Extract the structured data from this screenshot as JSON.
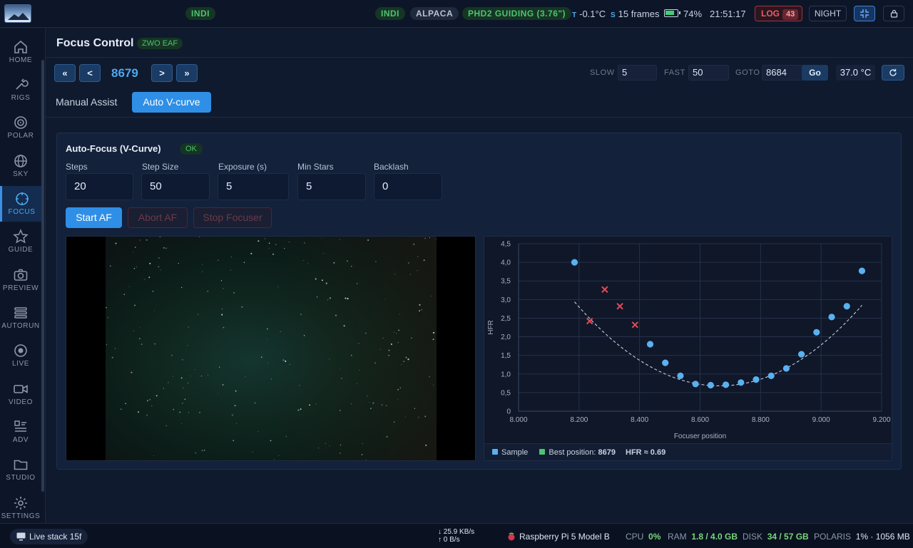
{
  "topbar": {
    "indi_left": "INDI",
    "indi": "INDI",
    "alpaca": "ALPACA",
    "phd2": "PHD2 GUIDING (3.76\")",
    "temp_key": "T",
    "temp_val": "-0.1°C",
    "frames_key": "S",
    "frames_val": "15 frames",
    "battery": "74%",
    "time": "21:51:17",
    "log_label": "LOG",
    "log_count": "43",
    "night_label": "NIGHT",
    "colors": {
      "accent": "#2f8fe6",
      "ok": "#4cc46f",
      "danger": "#ee5b65"
    }
  },
  "sidebar": {
    "items": [
      {
        "label": "HOME",
        "icon": "home-icon"
      },
      {
        "label": "RIGS",
        "icon": "wrench-icon"
      },
      {
        "label": "POLAR",
        "icon": "target-icon"
      },
      {
        "label": "SKY",
        "icon": "globe-icon"
      },
      {
        "label": "FOCUS",
        "icon": "focus-icon",
        "active": true
      },
      {
        "label": "GUIDE",
        "icon": "star-icon"
      },
      {
        "label": "PREVIEW",
        "icon": "camera-icon"
      },
      {
        "label": "AUTORUN",
        "icon": "stack-icon"
      },
      {
        "label": "LIVE",
        "icon": "record-icon"
      },
      {
        "label": "VIDEO",
        "icon": "video-icon"
      },
      {
        "label": "ADV",
        "icon": "list-icon"
      },
      {
        "label": "STUDIO",
        "icon": "folder-icon"
      },
      {
        "label": "SETTINGS",
        "icon": "gear-icon"
      }
    ]
  },
  "header": {
    "title": "Focus Control",
    "device": "ZWO EAF"
  },
  "control": {
    "btn_first": "«",
    "btn_prev": "<",
    "position": "8679",
    "btn_next": ">",
    "btn_last": "»",
    "slow_label": "SLOW",
    "slow_value": "5",
    "fast_label": "FAST",
    "fast_value": "50",
    "goto_label": "GOTO",
    "goto_value": "8684",
    "go_label": "Go",
    "temperature": "37.0 °C"
  },
  "tabs": {
    "manual": "Manual Assist",
    "auto": "Auto V-curve"
  },
  "af": {
    "title": "Auto-Focus (V-Curve)",
    "status": "OK",
    "fields": [
      {
        "label": "Steps",
        "value": "20"
      },
      {
        "label": "Step Size",
        "value": "50"
      },
      {
        "label": "Exposure (s)",
        "value": "5"
      },
      {
        "label": "Min Stars",
        "value": "5"
      },
      {
        "label": "Backlash",
        "value": "0"
      }
    ],
    "start": "Start AF",
    "abort": "Abort AF",
    "stop": "Stop Focuser"
  },
  "legend": {
    "sample": "Sample",
    "best_label": "Best position:",
    "best_value": "8679",
    "hfr": "HFR ≈ 0.69",
    "sample_color": "#5ab0f0",
    "best_color": "#4cc46f"
  },
  "chart_data": {
    "type": "scatter",
    "xlabel": "Focuser position",
    "ylabel": "HFR",
    "xlim": [
      8000,
      9200
    ],
    "ylim": [
      0,
      4.5
    ],
    "xticks": [
      "8.000",
      "8.200",
      "8.400",
      "8.600",
      "8.800",
      "9.000",
      "9.200"
    ],
    "yticks": [
      "0",
      "0,5",
      "1,0",
      "1,5",
      "2,0",
      "2,5",
      "3,0",
      "3,5",
      "4,0",
      "4,5"
    ],
    "grid": true,
    "series": [
      {
        "name": "Sample",
        "color": "#5ab0f0",
        "marker": "circle",
        "points": [
          [
            8185,
            4.0
          ],
          [
            8435,
            1.8
          ],
          [
            8485,
            1.3
          ],
          [
            8535,
            0.95
          ],
          [
            8585,
            0.73
          ],
          [
            8635,
            0.7
          ],
          [
            8685,
            0.71
          ],
          [
            8735,
            0.77
          ],
          [
            8785,
            0.85
          ],
          [
            8835,
            0.95
          ],
          [
            8885,
            1.15
          ],
          [
            8935,
            1.53
          ],
          [
            8985,
            2.12
          ],
          [
            9035,
            2.53
          ],
          [
            9085,
            2.82
          ],
          [
            9135,
            3.77
          ]
        ]
      },
      {
        "color": "#e04a55",
        "marker": "x",
        "points": [
          [
            8235,
            2.42
          ],
          [
            8285,
            3.27
          ],
          [
            8335,
            2.82
          ],
          [
            8385,
            2.32
          ]
        ]
      }
    ],
    "fit": {
      "style": "dashed",
      "color": "#c8d0dc",
      "a": 9.8e-06,
      "h": 8665,
      "k": 0.68
    }
  },
  "statusbar": {
    "livestack": "Live stack 15f",
    "down": "25.9 KB/s",
    "up": "0 B/s",
    "device": "Raspberry Pi 5 Model B",
    "cpu_label": "CPU",
    "cpu": "0%",
    "ram_label": "RAM",
    "ram": "1.8 / 4.0 GB",
    "disk_label": "DISK",
    "disk": "34 / 57 GB",
    "polaris_label": "POLARIS",
    "polaris": "1% · 1056 MB"
  }
}
